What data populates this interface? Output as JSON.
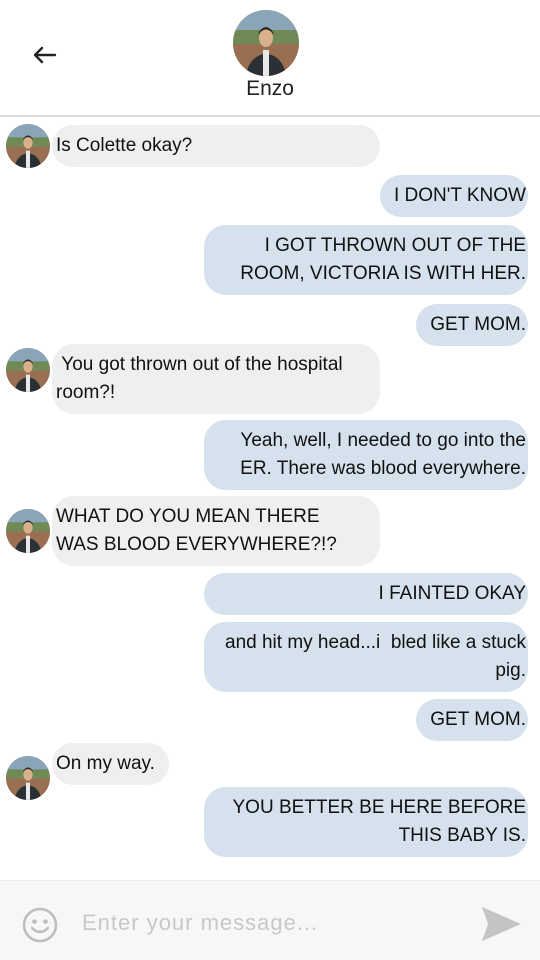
{
  "header": {
    "contact_name": "Enzo",
    "back_icon": "arrow-left-icon"
  },
  "messages": [
    {
      "side": "received",
      "text": "Is Colette okay?"
    },
    {
      "side": "sent",
      "text": "I DON'T KNOW"
    },
    {
      "side": "sent",
      "text": "I GOT THROWN OUT OF THE ROOM, VICTORIA IS WITH HER."
    },
    {
      "side": "sent",
      "text": "GET MOM."
    },
    {
      "side": "received",
      "text": " You got thrown out of the hospital room?!"
    },
    {
      "side": "sent",
      "text": "Yeah, well, I needed to go into the ER. There was blood everywhere."
    },
    {
      "side": "received",
      "text": "WHAT DO YOU MEAN THERE WAS BLOOD EVERYWHERE?!?"
    },
    {
      "side": "sent",
      "text": "I FAINTED OKAY"
    },
    {
      "side": "sent",
      "text": "and hit my head...i  bled like a stuck pig."
    },
    {
      "side": "sent",
      "text": "GET MOM."
    },
    {
      "side": "received",
      "text": "On my way."
    },
    {
      "side": "sent",
      "text": "YOU BETTER BE HERE BEFORE THIS BABY IS."
    }
  ],
  "composer": {
    "placeholder": "Enter your message...",
    "emoji_icon": "smiley-face-icon",
    "send_icon": "send-arrow-icon"
  },
  "colors": {
    "sent_bubble": "#d5e1ec",
    "received_bubble": "#efefef",
    "header_border": "#dcdcdc"
  }
}
